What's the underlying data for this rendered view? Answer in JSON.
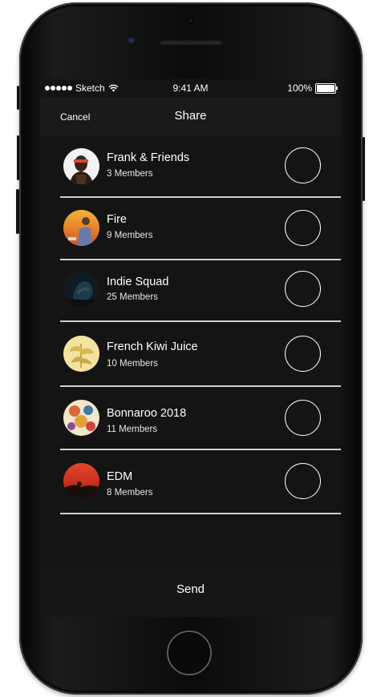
{
  "status_bar": {
    "carrier": "Sketch",
    "time": "9:41 AM",
    "battery": "100%"
  },
  "nav": {
    "cancel_label": "Cancel",
    "title": "Share"
  },
  "groups": [
    {
      "name": "Frank & Friends",
      "members": "3 Members"
    },
    {
      "name": "Fire",
      "members": "9 Members"
    },
    {
      "name": "Indie Squad",
      "members": "25 Members"
    },
    {
      "name": "French Kiwi Juice",
      "members": "10 Members"
    },
    {
      "name": "Bonnaroo 2018",
      "members": "11 Members"
    },
    {
      "name": "EDM",
      "members": "8 Members"
    }
  ],
  "send_label": "Send",
  "icons": {
    "signal": "signal-dots-icon",
    "wifi": "wifi-icon",
    "battery": "battery-icon"
  }
}
